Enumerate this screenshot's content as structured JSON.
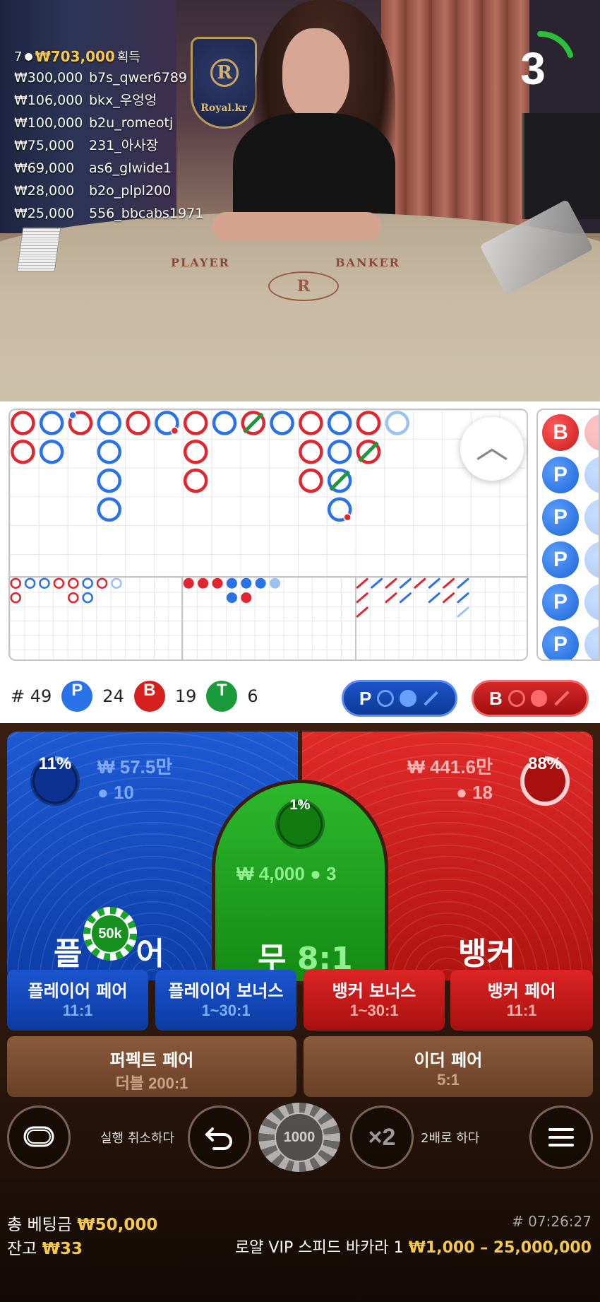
{
  "video": {
    "logo_letter": "R",
    "logo_text": "Royal.kr",
    "table_player": "PLAYER",
    "table_banker": "BANKER",
    "timer": "3"
  },
  "bets_list": {
    "count": "7",
    "total": "₩703,000",
    "won_label": "획득",
    "rows": [
      {
        "amount": "₩300,000",
        "user": "b7s_qwer6789"
      },
      {
        "amount": "₩106,000",
        "user": "bkx_우엉엉"
      },
      {
        "amount": "₩100,000",
        "user": "b2u_romeotj"
      },
      {
        "amount": "₩75,000",
        "user": "231_아사장"
      },
      {
        "amount": "₩69,000",
        "user": "as6_glwide1"
      },
      {
        "amount": "₩28,000",
        "user": "b2o_plpl200"
      },
      {
        "amount": "₩25,000",
        "user": "556_bbcabs1971"
      }
    ]
  },
  "side_road": [
    "B",
    "P",
    "P",
    "P",
    "P",
    "P"
  ],
  "stats": {
    "hash": "#",
    "total": "49",
    "p_label": "P",
    "p_count": "24",
    "b_label": "B",
    "b_count": "19",
    "t_label": "T",
    "t_count": "6"
  },
  "predict": {
    "player": "P",
    "banker": "B"
  },
  "player_zone": {
    "pct": "11%",
    "pct_value": 11,
    "amount": "₩ 57.5만",
    "players": "10",
    "title_left": "플",
    "title_right": "어",
    "chip": "50k"
  },
  "banker_zone": {
    "pct": "88%",
    "pct_value": 88,
    "amount": "₩ 441.6만",
    "players": "18",
    "title": "뱅커"
  },
  "tie_zone": {
    "pct": "1%",
    "pct_value": 1,
    "amount": "₩ 4,000",
    "players": "3",
    "title": "무",
    "odds": "8:1"
  },
  "side_bets": [
    {
      "title": "플레이어 페어",
      "odds": "11:1"
    },
    {
      "title": "플레이어 보너스",
      "odds": "1~30:1"
    },
    {
      "title": "뱅커 보너스",
      "odds": "1~30:1"
    },
    {
      "title": "뱅커 페어",
      "odds": "11:1"
    }
  ],
  "wide_bets": [
    {
      "title": "퍼펙트 페어",
      "odds": "더블 200:1"
    },
    {
      "title": "이더 페어",
      "odds": "5:1"
    }
  ],
  "controls": {
    "undo": "실행 취소하다",
    "chip": "1000",
    "double_icon": "×2",
    "double": "2배로 하다"
  },
  "footer": {
    "total_label": "총 베팅금",
    "total": "₩50,000",
    "balance_label": "잔고",
    "balance": "₩33",
    "round": "# 07:26:27",
    "table_name": "로얄 VIP 스피드 바카라 1",
    "limits": "₩1,000 – 25,000,000"
  },
  "colors": {
    "player": "#1e5ad4",
    "banker": "#e02a2a",
    "tie": "#2db82d",
    "gold": "#f7c948"
  },
  "roads": {
    "big_road": [
      {
        "col": 0,
        "row": 0,
        "c": "B"
      },
      {
        "col": 0,
        "row": 1,
        "c": "B"
      },
      {
        "col": 1,
        "row": 0,
        "c": "P"
      },
      {
        "col": 1,
        "row": 1,
        "c": "P"
      },
      {
        "col": 2,
        "row": 0,
        "c": "B",
        "pair": "P"
      },
      {
        "col": 3,
        "row": 0,
        "c": "P"
      },
      {
        "col": 3,
        "row": 1,
        "c": "P"
      },
      {
        "col": 3,
        "row": 2,
        "c": "P"
      },
      {
        "col": 3,
        "row": 3,
        "c": "P"
      },
      {
        "col": 4,
        "row": 0,
        "c": "B"
      },
      {
        "col": 5,
        "row": 0,
        "c": "P",
        "pair": "B"
      },
      {
        "col": 6,
        "row": 0,
        "c": "B"
      },
      {
        "col": 6,
        "row": 1,
        "c": "B"
      },
      {
        "col": 6,
        "row": 2,
        "c": "B"
      },
      {
        "col": 7,
        "row": 0,
        "c": "P"
      },
      {
        "col": 8,
        "row": 0,
        "c": "B",
        "tie": true
      },
      {
        "col": 9,
        "row": 0,
        "c": "P"
      },
      {
        "col": 10,
        "row": 0,
        "c": "B"
      },
      {
        "col": 10,
        "row": 1,
        "c": "B"
      },
      {
        "col": 10,
        "row": 2,
        "c": "B"
      },
      {
        "col": 11,
        "row": 0,
        "c": "P"
      },
      {
        "col": 11,
        "row": 1,
        "c": "P"
      },
      {
        "col": 11,
        "row": 2,
        "c": "P",
        "tie": true
      },
      {
        "col": 11,
        "row": 3,
        "c": "P",
        "pair": "B"
      },
      {
        "col": 12,
        "row": 0,
        "c": "B"
      },
      {
        "col": 12,
        "row": 1,
        "c": "B",
        "tie": true
      },
      {
        "col": 13,
        "row": 0,
        "c": "P",
        "pending": true
      }
    ],
    "big_eye": [
      {
        "col": 0,
        "row": 0,
        "c": "B"
      },
      {
        "col": 0,
        "row": 1,
        "c": "B"
      },
      {
        "col": 1,
        "row": 0,
        "c": "P"
      },
      {
        "col": 2,
        "row": 0,
        "c": "P"
      },
      {
        "col": 3,
        "row": 0,
        "c": "B"
      },
      {
        "col": 4,
        "row": 0,
        "c": "B"
      },
      {
        "col": 4,
        "row": 1,
        "c": "B"
      },
      {
        "col": 5,
        "row": 0,
        "c": "P"
      },
      {
        "col": 5,
        "row": 1,
        "c": "P"
      },
      {
        "col": 6,
        "row": 0,
        "c": "B"
      },
      {
        "col": 7,
        "row": 0,
        "c": "P",
        "pending": true
      }
    ],
    "small": [
      {
        "col": 0,
        "row": 0,
        "c": "B"
      },
      {
        "col": 1,
        "row": 0,
        "c": "B"
      },
      {
        "col": 2,
        "row": 0,
        "c": "B"
      },
      {
        "col": 3,
        "row": 0,
        "c": "P"
      },
      {
        "col": 3,
        "row": 1,
        "c": "P"
      },
      {
        "col": 4,
        "row": 0,
        "c": "P"
      },
      {
        "col": 4,
        "row": 1,
        "c": "B"
      },
      {
        "col": 5,
        "row": 0,
        "c": "P"
      },
      {
        "col": 6,
        "row": 0,
        "c": "P",
        "pending": true
      }
    ],
    "cockroach": [
      {
        "col": 0,
        "row": 0,
        "c": "B"
      },
      {
        "col": 0,
        "row": 1,
        "c": "B"
      },
      {
        "col": 0,
        "row": 2,
        "c": "B"
      },
      {
        "col": 1,
        "row": 0,
        "c": "P"
      },
      {
        "col": 2,
        "row": 0,
        "c": "B"
      },
      {
        "col": 2,
        "row": 1,
        "c": "B"
      },
      {
        "col": 3,
        "row": 0,
        "c": "P"
      },
      {
        "col": 3,
        "row": 1,
        "c": "P"
      },
      {
        "col": 4,
        "row": 0,
        "c": "B"
      },
      {
        "col": 5,
        "row": 0,
        "c": "P"
      },
      {
        "col": 5,
        "row": 1,
        "c": "P"
      },
      {
        "col": 6,
        "row": 0,
        "c": "B"
      },
      {
        "col": 6,
        "row": 1,
        "c": "B"
      },
      {
        "col": 7,
        "row": 0,
        "c": "P"
      },
      {
        "col": 7,
        "row": 1,
        "c": "P"
      },
      {
        "col": 7,
        "row": 2,
        "c": "P",
        "pending": true
      }
    ]
  }
}
